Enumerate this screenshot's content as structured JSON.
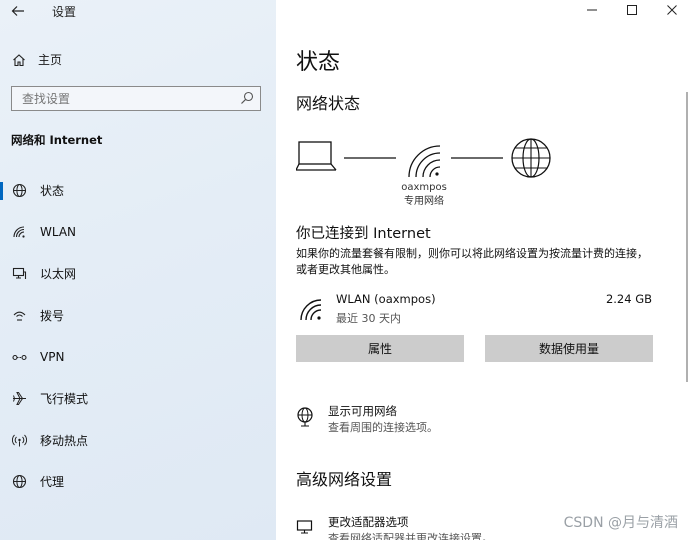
{
  "window": {
    "title": "设置",
    "controls": {
      "minimize_icon": "minimize-icon",
      "maximize_icon": "maximize-icon",
      "close_icon": "close-icon"
    }
  },
  "sidebar": {
    "home_label": "主页",
    "search_placeholder": "查找设置",
    "section_label": "网络和 Internet",
    "items": [
      {
        "label": "状态",
        "icon": "status-globe-icon",
        "active": true
      },
      {
        "label": "WLAN",
        "icon": "wifi-icon"
      },
      {
        "label": "以太网",
        "icon": "ethernet-icon"
      },
      {
        "label": "拨号",
        "icon": "dialup-icon"
      },
      {
        "label": "VPN",
        "icon": "vpn-icon"
      },
      {
        "label": "飞行模式",
        "icon": "airplane-icon"
      },
      {
        "label": "移动热点",
        "icon": "hotspot-icon"
      },
      {
        "label": "代理",
        "icon": "globe-icon"
      }
    ]
  },
  "main": {
    "title": "状态",
    "network_status_heading": "网络状态",
    "network": {
      "name": "oaxmpos",
      "type": "专用网络"
    },
    "connected_title": "你已连接到 Internet",
    "connected_desc": "如果你的流量套餐有限制，则你可以将此网络设置为按流量计费的连接，或者更改其他属性。",
    "wlan": {
      "name": "WLAN (oaxmpos)",
      "period": "最近 30 天内",
      "usage": "2.24 GB"
    },
    "buttons": {
      "properties": "属性",
      "data_usage": "数据使用量"
    },
    "show_networks": {
      "title": "显示可用网络",
      "desc": "查看周围的连接选项。"
    },
    "advanced_heading": "高级网络设置",
    "adapter_options": {
      "title": "更改适配器选项",
      "desc": "查看网络适配器并更改连接设置。"
    }
  },
  "watermark": "CSDN @月与清酒",
  "colors": {
    "accent": "#0067c0",
    "button_bg": "#cccccc",
    "sidebar_bg": "#e4edf6"
  }
}
